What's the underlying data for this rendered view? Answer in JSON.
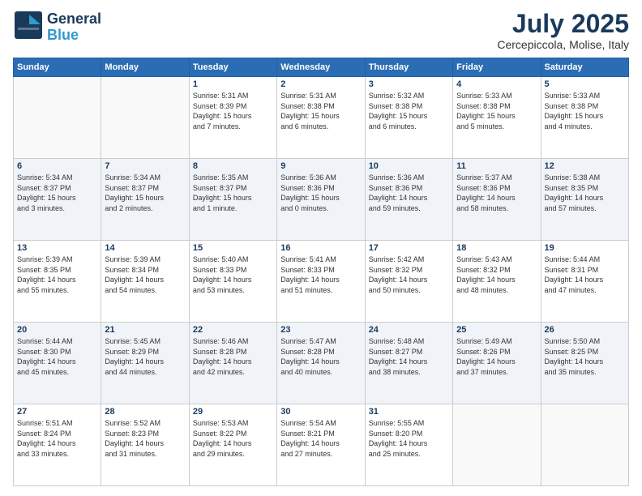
{
  "header": {
    "logo_general": "General",
    "logo_blue": "Blue",
    "month_title": "July 2025",
    "location": "Cercepiccola, Molise, Italy"
  },
  "weekdays": [
    "Sunday",
    "Monday",
    "Tuesday",
    "Wednesday",
    "Thursday",
    "Friday",
    "Saturday"
  ],
  "weeks": [
    [
      {
        "day": "",
        "info": ""
      },
      {
        "day": "",
        "info": ""
      },
      {
        "day": "1",
        "info": "Sunrise: 5:31 AM\nSunset: 8:39 PM\nDaylight: 15 hours\nand 7 minutes."
      },
      {
        "day": "2",
        "info": "Sunrise: 5:31 AM\nSunset: 8:38 PM\nDaylight: 15 hours\nand 6 minutes."
      },
      {
        "day": "3",
        "info": "Sunrise: 5:32 AM\nSunset: 8:38 PM\nDaylight: 15 hours\nand 6 minutes."
      },
      {
        "day": "4",
        "info": "Sunrise: 5:33 AM\nSunset: 8:38 PM\nDaylight: 15 hours\nand 5 minutes."
      },
      {
        "day": "5",
        "info": "Sunrise: 5:33 AM\nSunset: 8:38 PM\nDaylight: 15 hours\nand 4 minutes."
      }
    ],
    [
      {
        "day": "6",
        "info": "Sunrise: 5:34 AM\nSunset: 8:37 PM\nDaylight: 15 hours\nand 3 minutes."
      },
      {
        "day": "7",
        "info": "Sunrise: 5:34 AM\nSunset: 8:37 PM\nDaylight: 15 hours\nand 2 minutes."
      },
      {
        "day": "8",
        "info": "Sunrise: 5:35 AM\nSunset: 8:37 PM\nDaylight: 15 hours\nand 1 minute."
      },
      {
        "day": "9",
        "info": "Sunrise: 5:36 AM\nSunset: 8:36 PM\nDaylight: 15 hours\nand 0 minutes."
      },
      {
        "day": "10",
        "info": "Sunrise: 5:36 AM\nSunset: 8:36 PM\nDaylight: 14 hours\nand 59 minutes."
      },
      {
        "day": "11",
        "info": "Sunrise: 5:37 AM\nSunset: 8:36 PM\nDaylight: 14 hours\nand 58 minutes."
      },
      {
        "day": "12",
        "info": "Sunrise: 5:38 AM\nSunset: 8:35 PM\nDaylight: 14 hours\nand 57 minutes."
      }
    ],
    [
      {
        "day": "13",
        "info": "Sunrise: 5:39 AM\nSunset: 8:35 PM\nDaylight: 14 hours\nand 55 minutes."
      },
      {
        "day": "14",
        "info": "Sunrise: 5:39 AM\nSunset: 8:34 PM\nDaylight: 14 hours\nand 54 minutes."
      },
      {
        "day": "15",
        "info": "Sunrise: 5:40 AM\nSunset: 8:33 PM\nDaylight: 14 hours\nand 53 minutes."
      },
      {
        "day": "16",
        "info": "Sunrise: 5:41 AM\nSunset: 8:33 PM\nDaylight: 14 hours\nand 51 minutes."
      },
      {
        "day": "17",
        "info": "Sunrise: 5:42 AM\nSunset: 8:32 PM\nDaylight: 14 hours\nand 50 minutes."
      },
      {
        "day": "18",
        "info": "Sunrise: 5:43 AM\nSunset: 8:32 PM\nDaylight: 14 hours\nand 48 minutes."
      },
      {
        "day": "19",
        "info": "Sunrise: 5:44 AM\nSunset: 8:31 PM\nDaylight: 14 hours\nand 47 minutes."
      }
    ],
    [
      {
        "day": "20",
        "info": "Sunrise: 5:44 AM\nSunset: 8:30 PM\nDaylight: 14 hours\nand 45 minutes."
      },
      {
        "day": "21",
        "info": "Sunrise: 5:45 AM\nSunset: 8:29 PM\nDaylight: 14 hours\nand 44 minutes."
      },
      {
        "day": "22",
        "info": "Sunrise: 5:46 AM\nSunset: 8:28 PM\nDaylight: 14 hours\nand 42 minutes."
      },
      {
        "day": "23",
        "info": "Sunrise: 5:47 AM\nSunset: 8:28 PM\nDaylight: 14 hours\nand 40 minutes."
      },
      {
        "day": "24",
        "info": "Sunrise: 5:48 AM\nSunset: 8:27 PM\nDaylight: 14 hours\nand 38 minutes."
      },
      {
        "day": "25",
        "info": "Sunrise: 5:49 AM\nSunset: 8:26 PM\nDaylight: 14 hours\nand 37 minutes."
      },
      {
        "day": "26",
        "info": "Sunrise: 5:50 AM\nSunset: 8:25 PM\nDaylight: 14 hours\nand 35 minutes."
      }
    ],
    [
      {
        "day": "27",
        "info": "Sunrise: 5:51 AM\nSunset: 8:24 PM\nDaylight: 14 hours\nand 33 minutes."
      },
      {
        "day": "28",
        "info": "Sunrise: 5:52 AM\nSunset: 8:23 PM\nDaylight: 14 hours\nand 31 minutes."
      },
      {
        "day": "29",
        "info": "Sunrise: 5:53 AM\nSunset: 8:22 PM\nDaylight: 14 hours\nand 29 minutes."
      },
      {
        "day": "30",
        "info": "Sunrise: 5:54 AM\nSunset: 8:21 PM\nDaylight: 14 hours\nand 27 minutes."
      },
      {
        "day": "31",
        "info": "Sunrise: 5:55 AM\nSunset: 8:20 PM\nDaylight: 14 hours\nand 25 minutes."
      },
      {
        "day": "",
        "info": ""
      },
      {
        "day": "",
        "info": ""
      }
    ]
  ]
}
